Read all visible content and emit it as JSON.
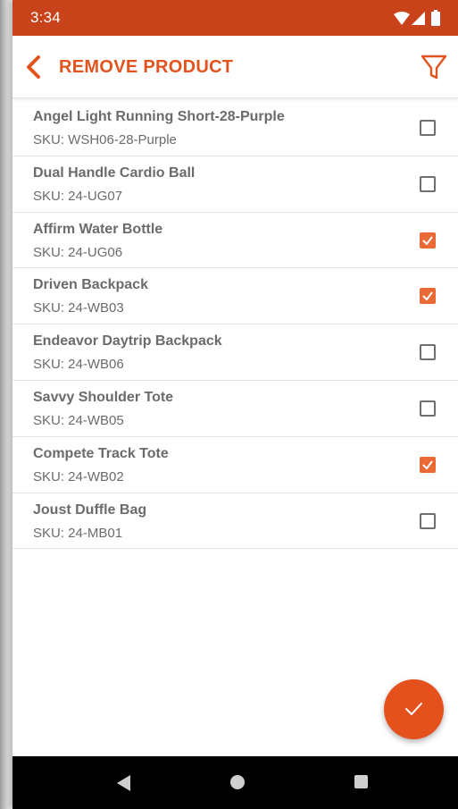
{
  "status_bar": {
    "time": "3:34",
    "icons": [
      "wifi-icon",
      "signal-icon",
      "battery-icon"
    ]
  },
  "app_bar": {
    "title": "REMOVE PRODUCT",
    "back_icon": "chevron-left-icon",
    "filter_icon": "filter-icon"
  },
  "colors": {
    "status_bar": "#c9431a",
    "accent": "#e2531e",
    "checkbox_checked": "#ea6a35",
    "fab": "#e4511d",
    "text": "#6b6b6b"
  },
  "products": [
    {
      "name": "Angel Light Running Short-28-Purple",
      "sku": "SKU: WSH06-28-Purple",
      "checked": false
    },
    {
      "name": "Dual Handle Cardio Ball",
      "sku": "SKU: 24-UG07",
      "checked": false
    },
    {
      "name": "Affirm Water Bottle",
      "sku": "SKU: 24-UG06",
      "checked": true
    },
    {
      "name": "Driven Backpack",
      "sku": "SKU: 24-WB03",
      "checked": true
    },
    {
      "name": "Endeavor Daytrip Backpack",
      "sku": "SKU: 24-WB06",
      "checked": false
    },
    {
      "name": "Savvy Shoulder Tote",
      "sku": "SKU: 24-WB05",
      "checked": false
    },
    {
      "name": "Compete Track Tote",
      "sku": "SKU: 24-WB02",
      "checked": true
    },
    {
      "name": "Joust Duffle Bag",
      "sku": "SKU: 24-MB01",
      "checked": false
    }
  ],
  "fab": {
    "icon": "check-icon"
  },
  "nav_bar": {
    "icons": [
      "nav-back-icon",
      "nav-home-icon",
      "nav-recents-icon"
    ]
  }
}
